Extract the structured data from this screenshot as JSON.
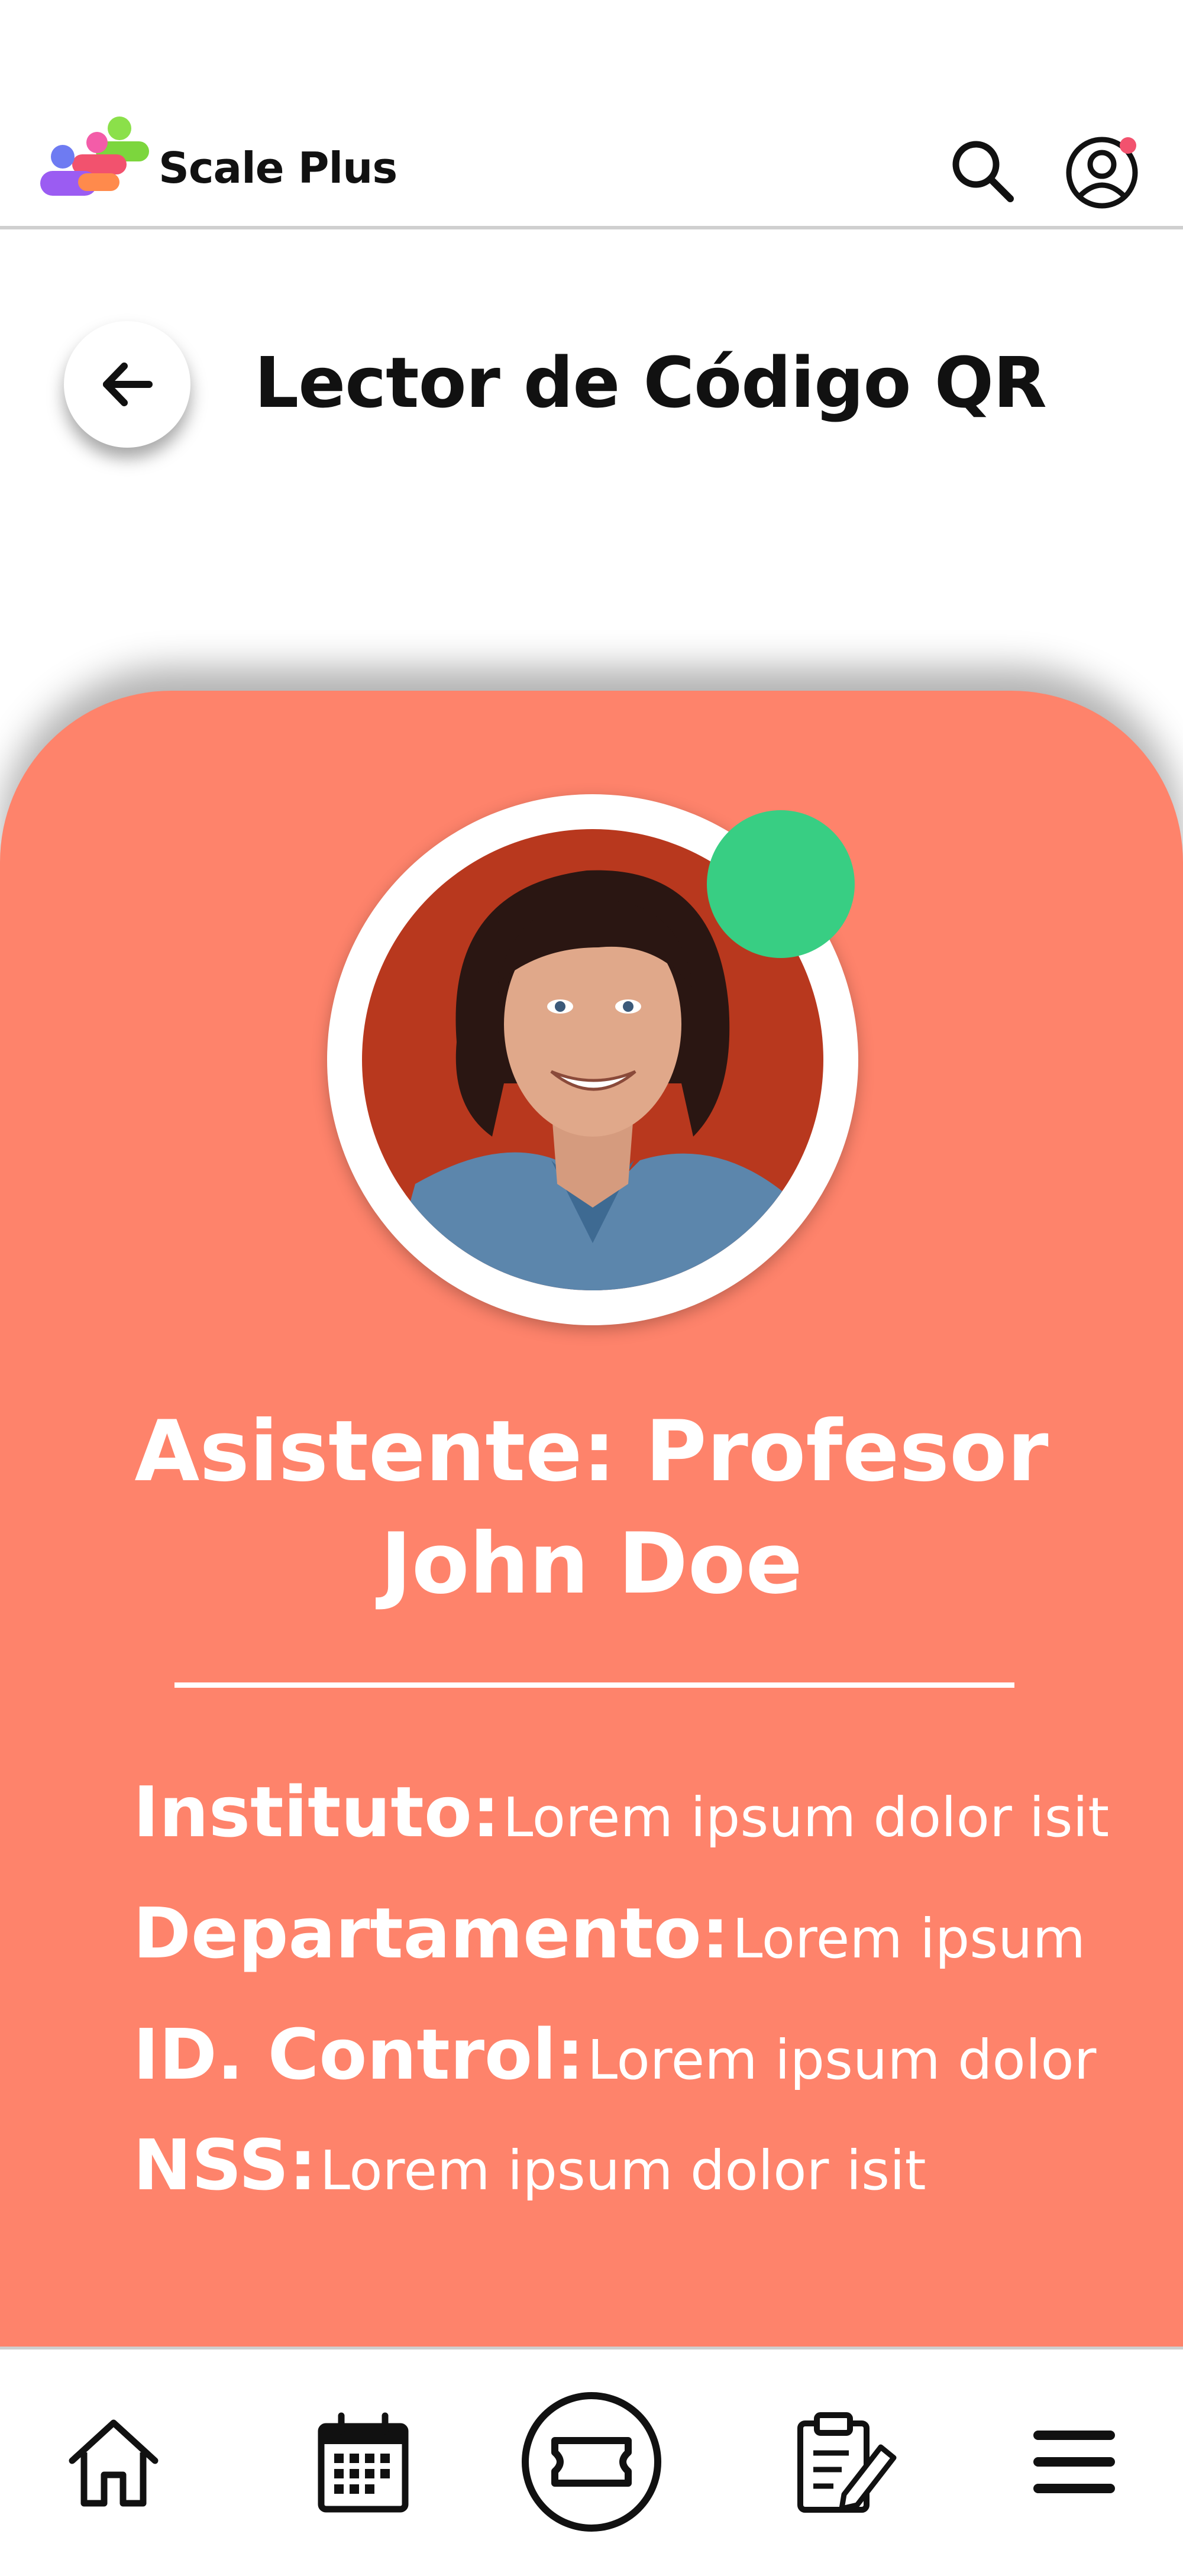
{
  "header": {
    "brand": "Scale Plus"
  },
  "icons": {
    "logo": "scale-plus-logo",
    "search": "search-icon",
    "profile": "user-circle-icon",
    "back": "arrow-left-icon",
    "home": "home-icon",
    "calendar": "calendar-icon",
    "ticket": "ticket-icon",
    "notes": "clipboard-edit-icon",
    "menu": "menu-icon"
  },
  "page": {
    "title": "Lector de Código QR"
  },
  "card": {
    "accent_color": "#FE836B",
    "status_color": "#38CE83",
    "attendee_line1": "Asistente: Profesor",
    "attendee_line2": "John Doe",
    "fields": [
      {
        "label": "Instituto:",
        "value": "Lorem ipsum dolor isit"
      },
      {
        "label": "Departamento:",
        "value": "Lorem ipsum"
      },
      {
        "label": "ID. Control:",
        "value": "Lorem ipsum dolor"
      },
      {
        "label": "NSS:",
        "value": "Lorem ipsum dolor isit"
      }
    ]
  }
}
